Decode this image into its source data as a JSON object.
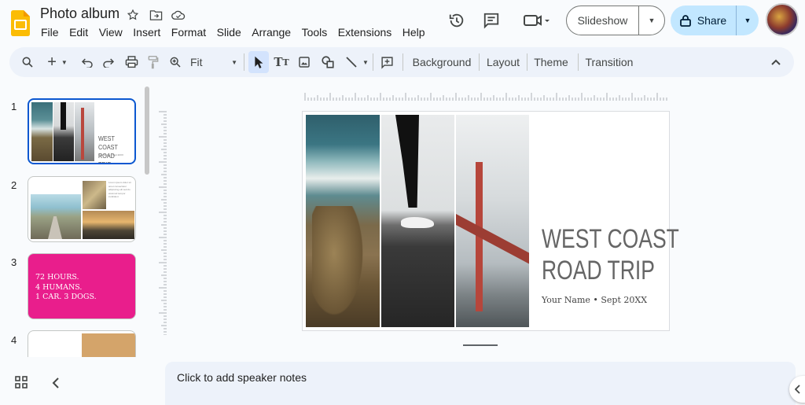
{
  "header": {
    "title": "Photo album",
    "menu": [
      "File",
      "Edit",
      "View",
      "Insert",
      "Format",
      "Slide",
      "Arrange",
      "Tools",
      "Extensions",
      "Help"
    ],
    "slideshow_label": "Slideshow",
    "share_label": "Share"
  },
  "toolbar": {
    "zoom_label": "Fit",
    "background_label": "Background",
    "layout_label": "Layout",
    "theme_label": "Theme",
    "transition_label": "Transition"
  },
  "filmstrip": {
    "slides": [
      {
        "number": "1",
        "title_line1": "WEST COAST",
        "title_line2": "ROAD TRIP",
        "subtitle": "Your Name • Sept 20XX"
      },
      {
        "number": "2",
        "body": "Lorem ipsum dolor sit amet consectetur adipiscing elit sed do eiusmod tempor incididunt"
      },
      {
        "number": "3",
        "line1": "72 HOURS.",
        "line2": "4 HUMANS.",
        "line3": "1 CAR. 3 DOGS."
      },
      {
        "number": "4"
      }
    ]
  },
  "slide": {
    "title_line1": "WEST COAST",
    "title_line2": "ROAD TRIP",
    "subtitle": "Your Name • Sept 20XX"
  },
  "notes": {
    "placeholder": "Click to add speaker notes"
  },
  "colors": {
    "accent": "#0b57d0",
    "share_bg": "#c2e7ff",
    "slide3_bg": "#e91e8c",
    "toolbar_bg": "#edf2fa"
  }
}
